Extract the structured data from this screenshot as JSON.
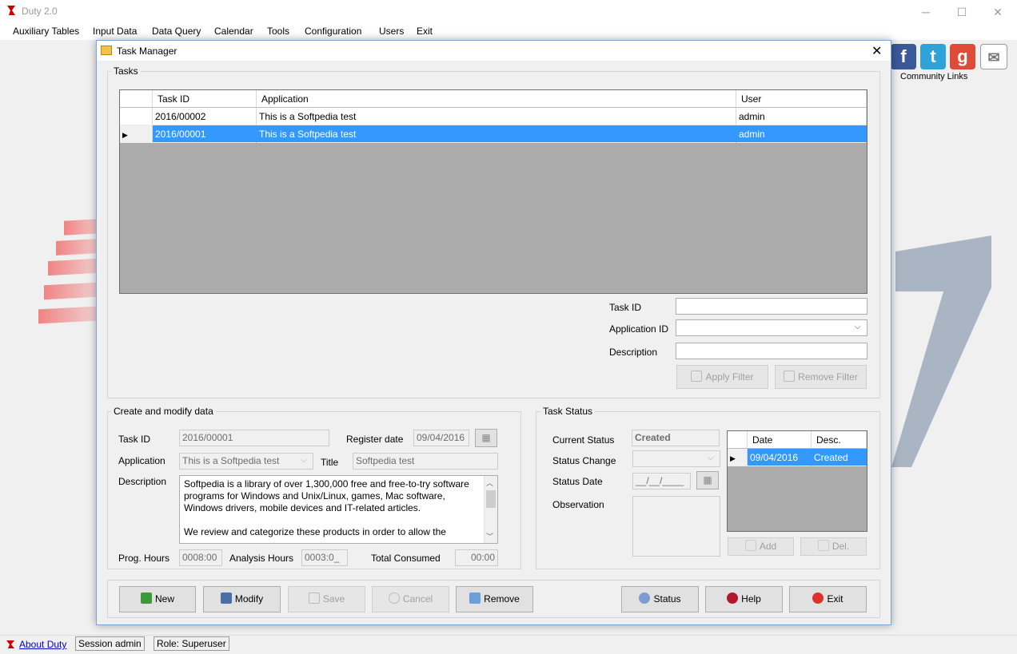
{
  "app": {
    "title": "Duty 2.0",
    "minimize_icon": "minimize-icon",
    "maximize_icon": "maximize-icon",
    "close_icon": "close-icon"
  },
  "menu": [
    "Auxiliary Tables",
    "Input Data",
    "Data Query",
    "Calendar",
    "Tools",
    "Configuration",
    "Users",
    "Exit"
  ],
  "community": {
    "label": "Community Links",
    "icons": [
      "facebook-icon",
      "twitter-icon",
      "google-icon",
      "mail-icon"
    ]
  },
  "statusbar": {
    "about": "About Duty",
    "session": "Session admin",
    "role": "Role: Superuser"
  },
  "dialog": {
    "title": "Task Manager",
    "close": "✕",
    "tasks": {
      "group_label": "Tasks",
      "columns": [
        "Task ID",
        "Application",
        "User"
      ],
      "rows": [
        {
          "task_id": "2016/00002",
          "application": "This is a Softpedia test",
          "user": "admin"
        },
        {
          "task_id": "2016/00001",
          "application": "This is a Softpedia test",
          "user": "admin"
        }
      ],
      "selected_row": 1
    },
    "filter": {
      "task_id_label": "Task ID",
      "task_id_value": "",
      "application_id_label": "Application ID",
      "application_id_value": "",
      "description_label": "Description",
      "description_value": "",
      "apply_filter": "Apply Filter",
      "remove_filter": "Remove Filter"
    },
    "create": {
      "group_label": "Create and modify data",
      "task_id_label": "Task ID",
      "task_id_value": "2016/00001",
      "register_date_label": "Register date",
      "register_date_value": "09/04/2016",
      "application_label": "Application",
      "application_value": "This is a Softpedia test",
      "title_label": "Title",
      "title_value": "Softpedia test",
      "description_label": "Description",
      "description_value": "Softpedia is a library of over 1,300,000 free and free-to-try software programs for Windows and Unix/Linux, games, Mac software, Windows drivers, mobile devices and IT-related articles.\n\nWe review and categorize these products in order to allow the",
      "prog_hours_label": "Prog. Hours",
      "prog_hours_value": "0008:00",
      "analysis_hours_label": "Analysis Hours",
      "analysis_hours_value": "0003:0_",
      "total_consumed_label": "Total Consumed",
      "total_consumed_value": "00:00"
    },
    "status": {
      "group_label": "Task Status",
      "current_status_label": "Current Status",
      "current_status_value": "Created",
      "status_change_label": "Status Change",
      "status_change_value": "",
      "status_date_label": "Status Date",
      "status_date_value": "__/__/____",
      "observation_label": "Observation",
      "observation_value": "",
      "columns": [
        "Date",
        "Desc."
      ],
      "rows": [
        {
          "date": "09/04/2016",
          "desc": "Created"
        }
      ],
      "add": "Add",
      "del": "Del."
    },
    "buttons": {
      "new": "New",
      "modify": "Modify",
      "save": "Save",
      "cancel": "Cancel",
      "remove": "Remove",
      "status": "Status",
      "help": "Help",
      "exit": "Exit"
    }
  }
}
